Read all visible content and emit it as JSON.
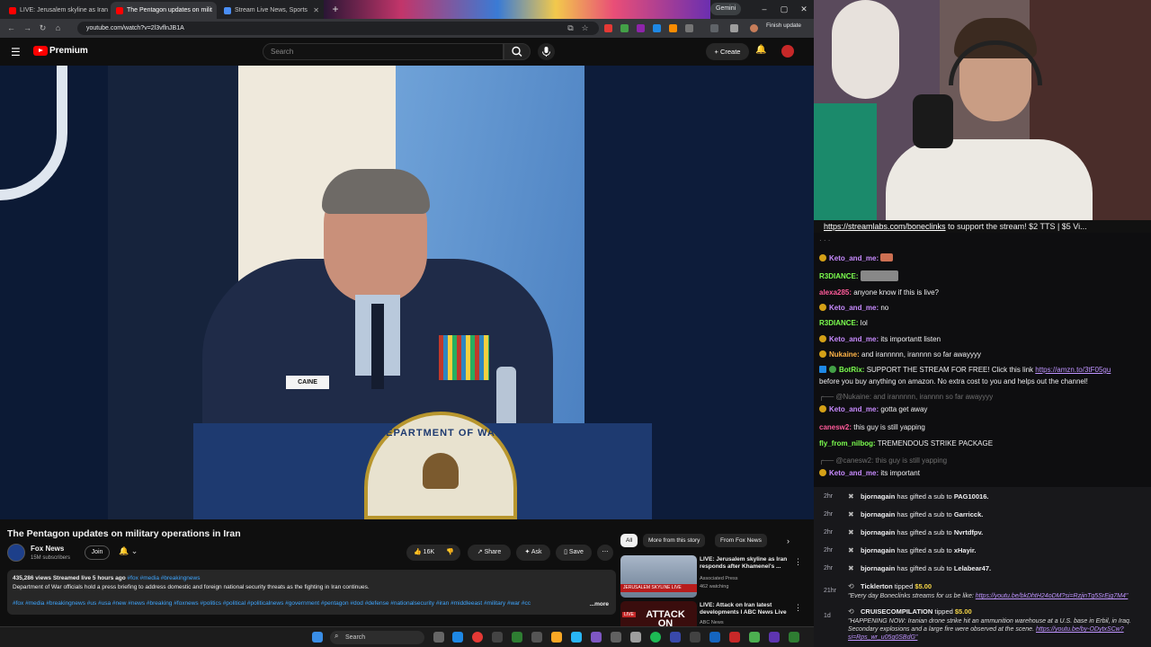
{
  "browser": {
    "tabs": [
      {
        "label": "LIVE: Jerusalem skyline as Iran",
        "active": false
      },
      {
        "label": "The Pentagon updates on milit",
        "active": true
      },
      {
        "label": "Stream Live News, Sports",
        "active": false
      }
    ],
    "new_tab": "+",
    "gemini_label": "Gemini",
    "url": "youtube.com/watch?v=2l3vflnJB1A",
    "finish_update": "Finish update",
    "window_controls": [
      "–",
      "▢",
      "✕"
    ]
  },
  "youtube": {
    "brand": "Premium",
    "search_placeholder": "Search",
    "create_label": "Create",
    "video": {
      "title": "The Pentagon updates on military operations in Iran",
      "channel": "Fox News",
      "subscribers": "15M subscribers",
      "join_label": "Join",
      "likes": "16K",
      "share_label": "Share",
      "ask_label": "Ask",
      "save_label": "Save",
      "nameplate": "CAINE",
      "seal_text": "DEPARTMENT OF WAR",
      "description": {
        "meta": "435,286 views  Streamed live 5 hours ago",
        "meta_tags": "#fox #media #breakingnews",
        "text": "Department of War officials hold a press briefing to address domestic and foreign national security threats as the fighting in Iran continues.",
        "tags": "#fox #media #breakingnews #us #usa #new #news #breaking #foxnews #politics #political #politicalnews #government #pentagon #dod #defense #nationalsecurity #iran #middleeast #military #war #cc",
        "more": "...more"
      }
    },
    "chips": [
      "All",
      "More from this story",
      "From Fox News"
    ],
    "recommendations": [
      {
        "title": "LIVE: Jerusalem skyline as Iran responds after Khamenei's ...",
        "channel": "Associated Press",
        "stat": "462 watching",
        "thumb_text": "JERUSALEM SKYLINE",
        "live": "LIVE"
      },
      {
        "title": "LIVE: Attack on Iran latest developments I ABC News Live",
        "channel": "ABC News",
        "stat": "",
        "thumb_text": "ATTACK ON",
        "live": "LIVE"
      }
    ]
  },
  "stream": {
    "tipbar": {
      "link": "https://streamlabs.com/boneclinks",
      "text": " to support the stream! $2 TTS | $5 Vi..."
    },
    "chat": [
      {
        "user": "Keto_and_me:",
        "color": "#c88bff",
        "text": "",
        "emote": true
      },
      {
        "user": "R3DIANCE:",
        "color": "#7cff4f",
        "text": "",
        "emote": true
      },
      {
        "user": "alexa285:",
        "color": "#ff5b9a",
        "text": "anyone know if this is live?"
      },
      {
        "user": "Keto_and_me:",
        "color": "#c88bff",
        "text": "no"
      },
      {
        "user": "R3DIANCE:",
        "color": "#7cff4f",
        "text": "lol"
      },
      {
        "user": "Keto_and_me:",
        "color": "#c88bff",
        "text": "its importantt listen"
      },
      {
        "user": "Nukaine:",
        "color": "#ffb347",
        "text": "and irannnnn, irannnn so far awayyyy"
      },
      {
        "user": "BotRix:",
        "color": "#7cff4f",
        "text": "SUPPORT THE STREAM FOR FREE! Click this link ",
        "link": "https://amzn.to/3tF05gu",
        "text2": "before you buy anything on amazon. No extra cost to you and helps out the channel!"
      },
      {
        "reply": "@Nukaine: and irannnnn, irannnn so far awayyyy"
      },
      {
        "user": "Keto_and_me:",
        "color": "#c88bff",
        "text": "gotta get away"
      },
      {
        "user": "canesw2:",
        "color": "#ff5b9a",
        "text": "this guy is still yapping"
      },
      {
        "user": "fly_from_nilbog:",
        "color": "#7cff4f",
        "text": "TREMENDOUS STRIKE PACKAGE"
      },
      {
        "reply": "@canesw2: this guy is still yapping"
      },
      {
        "user": "Keto_and_me:",
        "color": "#c88bff",
        "text": "its important"
      }
    ],
    "events": [
      {
        "time": "2hr",
        "user": "bjornagain",
        "action": " has gifted a sub to ",
        "target": "PAG10016."
      },
      {
        "time": "2hr",
        "user": "bjornagain",
        "action": " has gifted a sub to ",
        "target": "Garricck."
      },
      {
        "time": "2hr",
        "user": "bjornagain",
        "action": " has gifted a sub to ",
        "target": "Nvrtdfpv."
      },
      {
        "time": "2hr",
        "user": "bjornagain",
        "action": " has gifted a sub to ",
        "target": "xHayir."
      },
      {
        "time": "2hr",
        "user": "bjornagain",
        "action": " has gifted a sub to ",
        "target": "Lelabear47."
      }
    ],
    "tips": [
      {
        "time": "21hr",
        "user": "Ticklerton",
        "amount": "$5.00",
        "message": "\"Every day Boneclinks streams for us be like: ",
        "link": "https://youtu.be/bkDhtH24oDM?si=RzjinTg5SrEjg7M4\""
      },
      {
        "time": "1d",
        "user": "CRUISECOMPILATION",
        "amount": "$5.00",
        "message": "\"HAPPENING NOW: Iranian drone strike hit an ammunition warehouse at a U.S. base in Erbil, in Iraq.",
        "message2": "Secondary explosions and a large fire were observed at the scene. ",
        "link": "https://youtu.be/by-ODytxSCw?",
        "link2": "si=Rps_wr_u05g0SBdG\""
      }
    ],
    "tipped_label": " tipped "
  },
  "taskbar": {
    "search": "Search"
  }
}
